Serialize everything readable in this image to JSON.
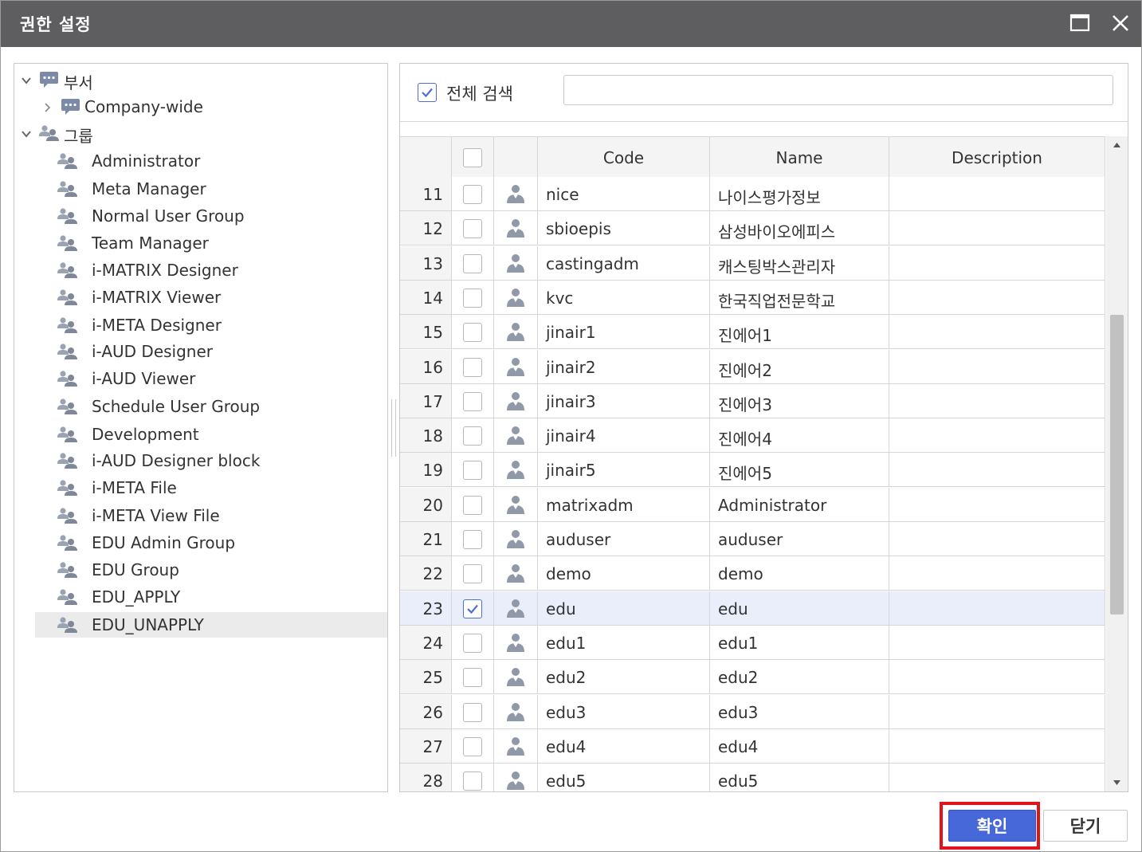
{
  "window": {
    "title": "권한 설정",
    "maximize_icon": "maximize-icon",
    "close_icon": "close-icon"
  },
  "tree": {
    "nodes": [
      {
        "label": "부서",
        "icon": "department-icon",
        "expand": "expanded"
      },
      {
        "label": "Company-wide",
        "icon": "department-icon",
        "expand": "collapsed"
      },
      {
        "label": "그룹",
        "icon": "group-icon",
        "expand": "expanded"
      },
      {
        "label": "Administrator",
        "icon": "group-icon"
      },
      {
        "label": "Meta Manager",
        "icon": "group-icon"
      },
      {
        "label": "Normal User Group",
        "icon": "group-icon"
      },
      {
        "label": "Team Manager",
        "icon": "group-icon"
      },
      {
        "label": "i-MATRIX Designer",
        "icon": "group-icon"
      },
      {
        "label": "i-MATRIX Viewer",
        "icon": "group-icon"
      },
      {
        "label": "i-META Designer",
        "icon": "group-icon"
      },
      {
        "label": "i-AUD Designer",
        "icon": "group-icon"
      },
      {
        "label": "i-AUD Viewer",
        "icon": "group-icon"
      },
      {
        "label": "Schedule User Group",
        "icon": "group-icon"
      },
      {
        "label": "Development",
        "icon": "group-icon"
      },
      {
        "label": "i-AUD Designer block",
        "icon": "group-icon"
      },
      {
        "label": "i-META File",
        "icon": "group-icon"
      },
      {
        "label": "i-META View File",
        "icon": "group-icon"
      },
      {
        "label": "EDU Admin Group",
        "icon": "group-icon"
      },
      {
        "label": "EDU Group",
        "icon": "group-icon"
      },
      {
        "label": "EDU_APPLY",
        "icon": "group-icon"
      },
      {
        "label": "EDU_UNAPPLY",
        "icon": "group-icon",
        "selected": true
      }
    ]
  },
  "search": {
    "checkbox_label": "전체 검색",
    "checked": true,
    "value": ""
  },
  "grid": {
    "columns": [
      "Code",
      "Name",
      "Description"
    ],
    "rows": [
      {
        "num": "11",
        "code": "nice",
        "name": "나이스평가정보",
        "desc": "",
        "checked": false
      },
      {
        "num": "12",
        "code": "sbioepis",
        "name": "삼성바이오에피스",
        "desc": "",
        "checked": false
      },
      {
        "num": "13",
        "code": "castingadm",
        "name": "캐스팅박스관리자",
        "desc": "",
        "checked": false
      },
      {
        "num": "14",
        "code": "kvc",
        "name": "한국직업전문학교",
        "desc": "",
        "checked": false
      },
      {
        "num": "15",
        "code": "jinair1",
        "name": "진에어1",
        "desc": "",
        "checked": false
      },
      {
        "num": "16",
        "code": "jinair2",
        "name": "진에어2",
        "desc": "",
        "checked": false
      },
      {
        "num": "17",
        "code": "jinair3",
        "name": "진에어3",
        "desc": "",
        "checked": false
      },
      {
        "num": "18",
        "code": "jinair4",
        "name": "진에어4",
        "desc": "",
        "checked": false
      },
      {
        "num": "19",
        "code": "jinair5",
        "name": "진에어5",
        "desc": "",
        "checked": false
      },
      {
        "num": "20",
        "code": "matrixadm",
        "name": "Administrator",
        "desc": "",
        "checked": false
      },
      {
        "num": "21",
        "code": "auduser",
        "name": "auduser",
        "desc": "",
        "checked": false
      },
      {
        "num": "22",
        "code": "demo",
        "name": "demo",
        "desc": "",
        "checked": false
      },
      {
        "num": "23",
        "code": "edu",
        "name": "edu",
        "desc": "",
        "checked": true
      },
      {
        "num": "24",
        "code": "edu1",
        "name": "edu1",
        "desc": "",
        "checked": false
      },
      {
        "num": "25",
        "code": "edu2",
        "name": "edu2",
        "desc": "",
        "checked": false
      },
      {
        "num": "26",
        "code": "edu3",
        "name": "edu3",
        "desc": "",
        "checked": false
      },
      {
        "num": "27",
        "code": "edu4",
        "name": "edu4",
        "desc": "",
        "checked": false
      },
      {
        "num": "28",
        "code": "edu5",
        "name": "edu5",
        "desc": "",
        "checked": false
      }
    ]
  },
  "buttons": {
    "ok": "확인",
    "close": "닫기"
  },
  "colors": {
    "titlebar": "#5e5e60",
    "accent": "#4768d8",
    "highlight_outline": "#e2141b",
    "selected_row": "#eaeefb",
    "icon": "#8f99a8"
  }
}
